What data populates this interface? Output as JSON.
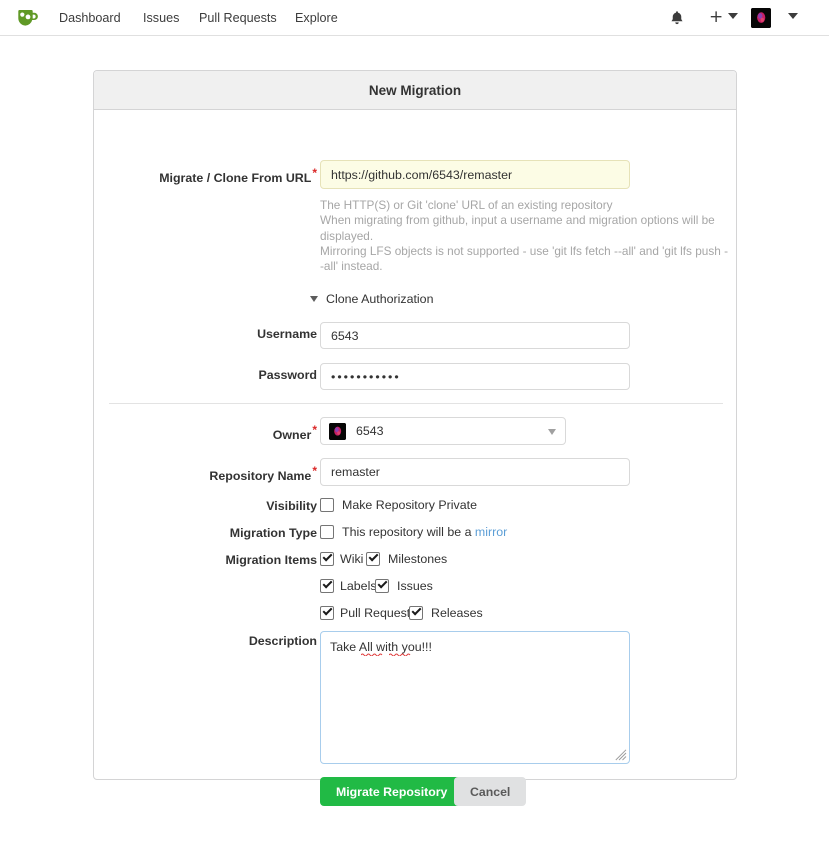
{
  "navbar": {
    "logo_icon": "gitea-logo-icon",
    "logo_color": "#609926",
    "links": [
      {
        "label": "Dashboard"
      },
      {
        "label": "Issues"
      },
      {
        "label": "Pull Requests"
      },
      {
        "label": "Explore"
      }
    ],
    "bell_icon": "bell-icon",
    "plus_label": "+",
    "plus_caret_icon": "chevron-down-icon",
    "avatar_icon": "user-avatar",
    "avatar_caret_icon": "chevron-down-icon"
  },
  "card": {
    "title": "New Migration"
  },
  "form": {
    "url": {
      "label": "Migrate / Clone From URL",
      "required": "*",
      "value": "https://github.com/6543/remaster",
      "placeholder": "",
      "help_lines": [
        "The HTTP(S) or Git 'clone' URL of an existing repository",
        "When migrating from github, input a username and migration options will be displayed.",
        "Mirroring LFS objects is not supported - use 'git lfs fetch --all' and 'git lfs push --all' instead."
      ]
    },
    "clone_auth": {
      "label": "Clone Authorization",
      "caret_icon": "caret-down-icon"
    },
    "username": {
      "label": "Username",
      "value": "6543",
      "placeholder": ""
    },
    "password": {
      "label": "Password",
      "value": "•••••••••••",
      "placeholder": ""
    },
    "owner": {
      "label": "Owner",
      "required": "*",
      "value": "6543",
      "avatar_icon": "owner-avatar",
      "caret_icon": "chevron-down-icon"
    },
    "repo_name": {
      "label": "Repository Name",
      "required": "*",
      "value": "remaster",
      "placeholder": ""
    },
    "visibility": {
      "label": "Visibility",
      "checkbox_label": "Make Repository Private",
      "checked": false
    },
    "migration_type": {
      "label": "Migration Type",
      "checkbox_text_before": "This repository will be a ",
      "checkbox_link": "mirror",
      "checked": false
    },
    "migration_items": {
      "label": "Migration Items",
      "items": [
        {
          "label": "Wiki",
          "checked": true
        },
        {
          "label": "Milestones",
          "checked": true
        },
        {
          "label": "Labels",
          "checked": true
        },
        {
          "label": "Issues",
          "checked": true
        },
        {
          "label": "Pull Requests",
          "checked": true
        },
        {
          "label": "Releases",
          "checked": true
        }
      ]
    },
    "description": {
      "label": "Description",
      "value": "Take All with you!!!",
      "placeholder": ""
    },
    "buttons": {
      "submit": "Migrate Repository",
      "cancel": "Cancel"
    }
  },
  "colors": {
    "brand_green": "#609926",
    "submit_green": "#21ba45",
    "required_red": "#db2828",
    "link_blue": "#5c9ed6",
    "autofill_yellow": "#fcfce5"
  }
}
